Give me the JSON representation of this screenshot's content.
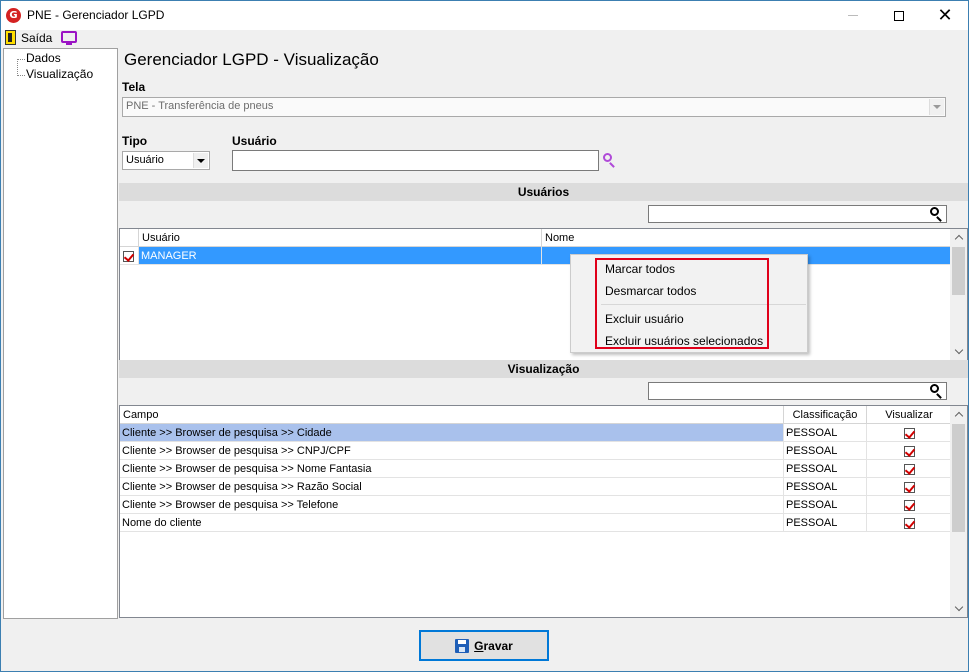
{
  "window": {
    "title": "PNE - Gerenciador LGPD",
    "app_icon_letter": "G",
    "controls": {
      "minimize": "—",
      "maximize": "□",
      "close": "✕"
    }
  },
  "toolbar": {
    "exit_label": "Saída",
    "exit_icon": "door-exit-icon",
    "monitor_icon": "monitor-icon"
  },
  "sidebar": {
    "items": [
      {
        "label": "Dados"
      },
      {
        "label": "Visualização"
      }
    ]
  },
  "main": {
    "title": "Gerenciador LGPD - Visualização",
    "tela_label": "Tela",
    "tela_value": "PNE - Transferência de pneus",
    "tipo_label": "Tipo",
    "tipo_value": "Usuário",
    "usuario_label": "Usuário",
    "usuario_value": ""
  },
  "usuarios": {
    "header": "Usuários",
    "search_value": "",
    "columns": [
      "Usuário",
      "Nome"
    ],
    "rows": [
      {
        "checked": true,
        "usuario": "MANAGER",
        "nome": ""
      }
    ]
  },
  "context_menu": {
    "items": [
      "Marcar todos",
      "Desmarcar todos",
      "Excluir usuário",
      "Excluir usuários selecionados"
    ],
    "highlight_color": "#e0001a"
  },
  "visualizacao": {
    "header": "Visualização",
    "search_value": "",
    "columns": [
      "Campo",
      "Classificação",
      "Visualizar"
    ],
    "rows": [
      {
        "campo": "Cliente >> Browser de pesquisa >> Cidade",
        "classificacao": "PESSOAL",
        "visualizar": true
      },
      {
        "campo": "Cliente >> Browser de pesquisa >> CNPJ/CPF",
        "classificacao": "PESSOAL",
        "visualizar": true
      },
      {
        "campo": "Cliente >> Browser de pesquisa >> Nome Fantasia",
        "classificacao": "PESSOAL",
        "visualizar": true
      },
      {
        "campo": "Cliente >> Browser de pesquisa >> Razão Social",
        "classificacao": "PESSOAL",
        "visualizar": true
      },
      {
        "campo": "Cliente >> Browser de pesquisa >> Telefone",
        "classificacao": "PESSOAL",
        "visualizar": true
      },
      {
        "campo": "Nome do cliente",
        "classificacao": "PESSOAL",
        "visualizar": true
      }
    ]
  },
  "footer": {
    "save_label_underlined": "G",
    "save_label_rest": "ravar",
    "save_icon": "floppy-disk-icon"
  },
  "colors": {
    "selection_blue": "#3399ff",
    "selection_light": "#a9c1ec",
    "check_red": "#d10000",
    "window_border": "#3c7fb1"
  }
}
